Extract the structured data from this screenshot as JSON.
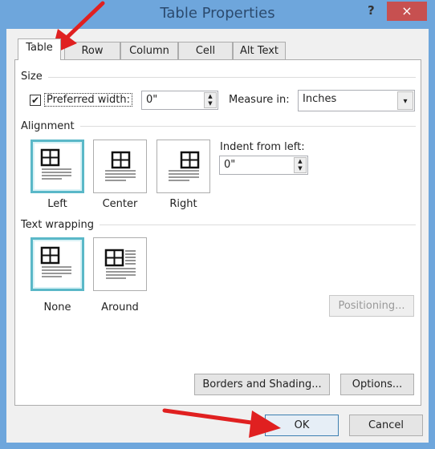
{
  "window": {
    "title": "Table Properties",
    "help": "?",
    "close": "×"
  },
  "tabs": [
    {
      "label": "Table",
      "active": true
    },
    {
      "label": "Row"
    },
    {
      "label": "Column"
    },
    {
      "label": "Cell"
    },
    {
      "label": "Alt Text"
    }
  ],
  "size": {
    "heading": "Size",
    "preferred_width_label": "Preferred width:",
    "preferred_width_checked": true,
    "preferred_width_value": "0\"",
    "measure_in_label": "Measure in:",
    "measure_in_value": "Inches"
  },
  "alignment": {
    "heading": "Alignment",
    "options": [
      "Left",
      "Center",
      "Right"
    ],
    "selected": "Left",
    "indent_label": "Indent from left:",
    "indent_value": "0\""
  },
  "wrapping": {
    "heading": "Text wrapping",
    "options": [
      "None",
      "Around"
    ],
    "selected": "None",
    "positioning": "Positioning..."
  },
  "buttons": {
    "borders": "Borders and Shading...",
    "options": "Options...",
    "ok": "OK",
    "cancel": "Cancel"
  },
  "annotation_color": "#e02020"
}
